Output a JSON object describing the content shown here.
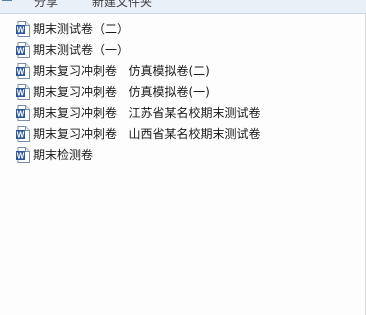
{
  "toolbar": {
    "share_label": "分享",
    "new_folder_label": "新建文件夹"
  },
  "icons": {
    "file_type": "word-document-icon",
    "accent": "#2b579a"
  },
  "files": [
    {
      "name": "期末测试卷（二）"
    },
    {
      "name": "期末测试卷（一）"
    },
    {
      "name": "期末复习冲刺卷   仿真模拟卷(二)"
    },
    {
      "name": "期末复习冲刺卷   仿真模拟卷(一)"
    },
    {
      "name": "期末复习冲刺卷   江苏省某名校期末测试卷"
    },
    {
      "name": "期末复习冲刺卷   山西省某名校期末测试卷"
    },
    {
      "name": "期末检测卷"
    }
  ]
}
